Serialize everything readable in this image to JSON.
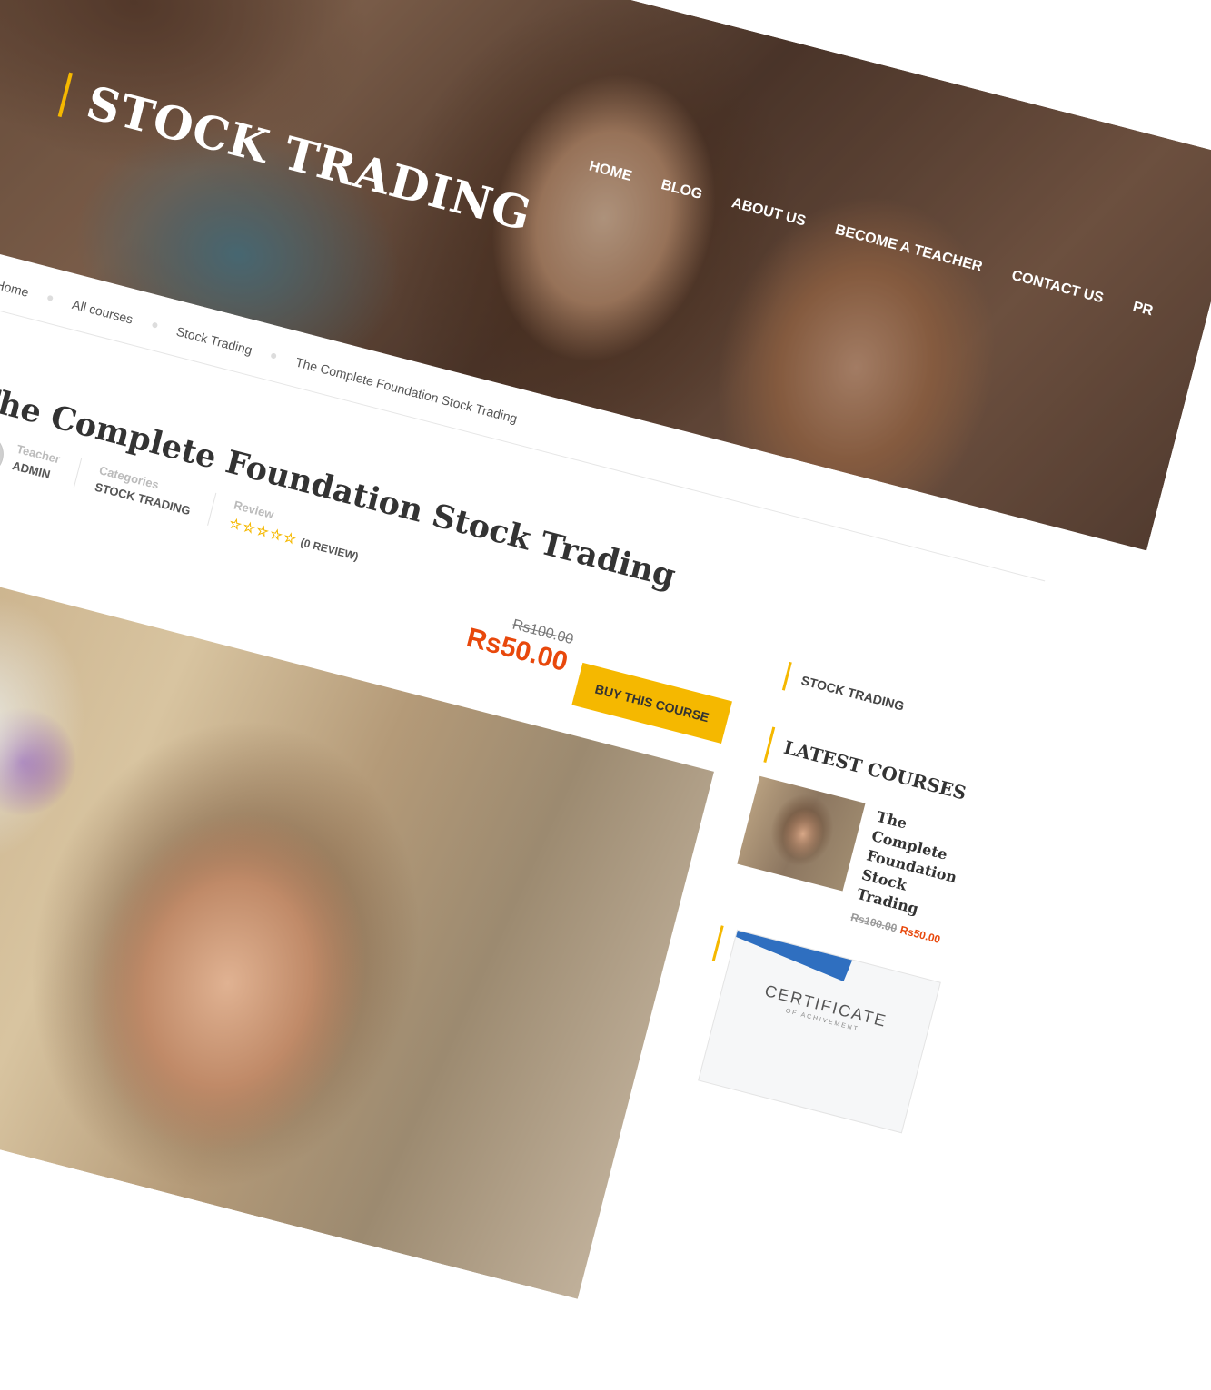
{
  "site": {
    "title": "STOCK TRADING"
  },
  "nav": {
    "items": [
      "HOME",
      "BLOG",
      "ABOUT US",
      "BECOME A TEACHER",
      "CONTACT US",
      "PR"
    ]
  },
  "breadcrumb": [
    "Home",
    "All courses",
    "Stock Trading",
    "The Complete Foundation Stock Trading"
  ],
  "course": {
    "title": "The Complete Foundation Stock Trading",
    "teacher_label": "Teacher",
    "teacher": "ADMIN",
    "categories_label": "Categories",
    "category": "STOCK TRADING",
    "review_label": "Review",
    "stars": "☆☆☆☆☆",
    "rating": 0,
    "review_count": "(0 REVIEW)",
    "old_price": "Rs100.00",
    "price": "Rs50.00",
    "buy_label": "BUY THIS COURSE"
  },
  "sidebar": {
    "category": "STOCK TRADING",
    "latest_heading": "LATEST COURSES",
    "latest": [
      {
        "title": "The Complete Foundation Stock Trading",
        "old_price": "Rs100.00",
        "price": "Rs50.00"
      }
    ],
    "certificate_title": "CERTIFICATE",
    "certificate_sub": "OF ACHIVEMENT"
  },
  "colors": {
    "accent": "#f5b800",
    "price": "#e8480c"
  }
}
